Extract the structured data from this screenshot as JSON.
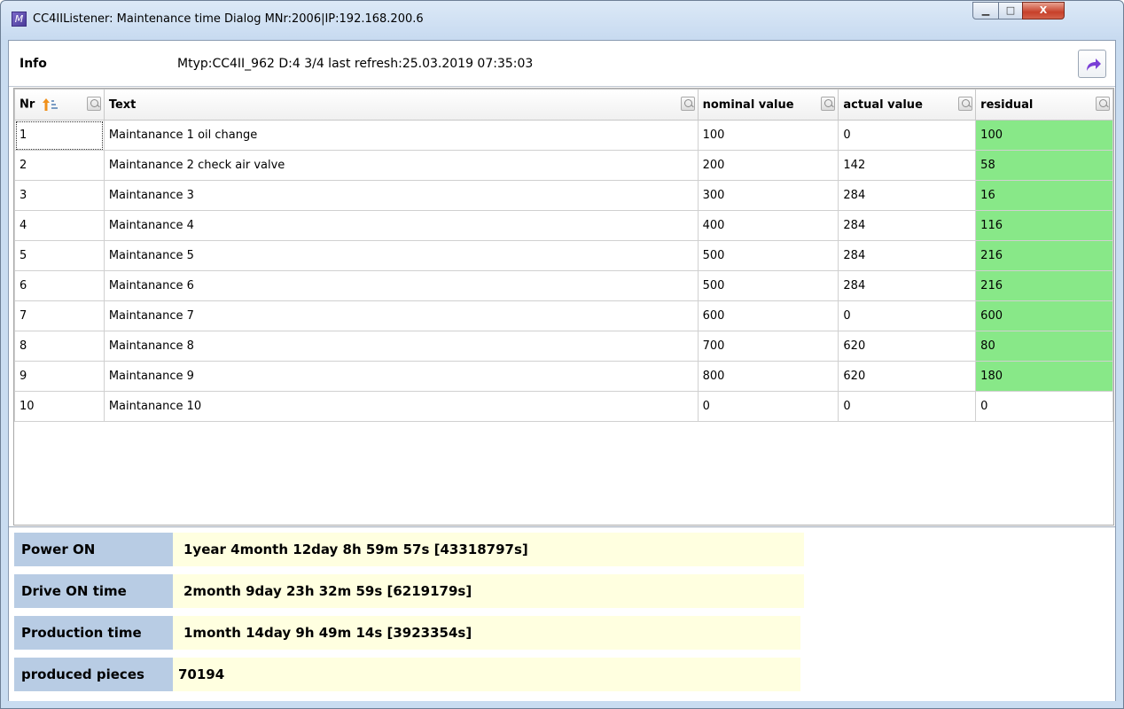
{
  "window": {
    "title": "CC4IIListener: Maintenance time Dialog MNr:2006|IP:192.168.200.6",
    "min_glyph": "▁",
    "max_glyph": "□",
    "close_glyph": "X"
  },
  "info": {
    "label": "Info",
    "status": "Mtyp:CC4II_962 D:4 3/4 last refresh:25.03.2019 07:35:03"
  },
  "table": {
    "headers": {
      "nr": "Nr",
      "text": "Text",
      "nominal": "nominal value",
      "actual": "actual value",
      "residual": "residual"
    },
    "rows": [
      {
        "nr": "1",
        "text": "Maintanance 1  oil change",
        "nominal": "100",
        "actual": "0",
        "residual": "100"
      },
      {
        "nr": "2",
        "text": "Maintanance 2 check air valve",
        "nominal": "200",
        "actual": "142",
        "residual": "58"
      },
      {
        "nr": "3",
        "text": "Maintanance 3",
        "nominal": "300",
        "actual": "284",
        "residual": "16"
      },
      {
        "nr": "4",
        "text": "Maintanance 4",
        "nominal": "400",
        "actual": "284",
        "residual": "116"
      },
      {
        "nr": "5",
        "text": "Maintanance 5",
        "nominal": "500",
        "actual": "284",
        "residual": "216"
      },
      {
        "nr": "6",
        "text": "Maintanance 6",
        "nominal": "500",
        "actual": "284",
        "residual": "216"
      },
      {
        "nr": "7",
        "text": "Maintanance 7",
        "nominal": "600",
        "actual": "0",
        "residual": "600"
      },
      {
        "nr": "8",
        "text": "Maintanance 8",
        "nominal": "700",
        "actual": "620",
        "residual": "80"
      },
      {
        "nr": "9",
        "text": "Maintanance 9",
        "nominal": "800",
        "actual": "620",
        "residual": "180"
      },
      {
        "nr": "10",
        "text": "Maintanance 10",
        "nominal": "0",
        "actual": "0",
        "residual": "0"
      }
    ]
  },
  "stats": {
    "power_on": {
      "label": "Power ON",
      "value": "1year 4month 12day 8h 59m 57s [43318797s]"
    },
    "drive_on": {
      "label": "Drive ON time",
      "value": "2month 9day 23h 32m 59s [6219179s]"
    },
    "production": {
      "label": "Production time",
      "value": "1month 14day 9h 49m 14s [3923354s]"
    },
    "pieces": {
      "label": "produced pieces",
      "value": "70194"
    }
  },
  "colors": {
    "residual_ok": "#88e888",
    "stat_label_bg": "#b8cce4",
    "stat_value_bg": "#ffffe0"
  }
}
